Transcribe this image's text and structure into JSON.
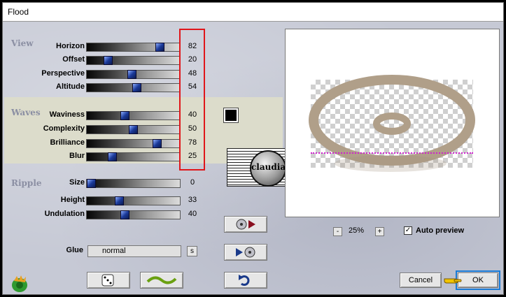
{
  "window": {
    "title": "Flood"
  },
  "sections": {
    "view": "View",
    "waves": "Waves",
    "ripple": "Ripple"
  },
  "params": [
    {
      "label": "Horizon",
      "value": 82
    },
    {
      "label": "Offset",
      "value": 20
    },
    {
      "label": "Perspective",
      "value": 48
    },
    {
      "label": "Altitude",
      "value": 54
    },
    {
      "label": "Waviness",
      "value": 40
    },
    {
      "label": "Complexity",
      "value": 50
    },
    {
      "label": "Brilliance",
      "value": 78
    },
    {
      "label": "Blur",
      "value": 25
    },
    {
      "label": "Size",
      "value": 0
    },
    {
      "label": "Height",
      "value": 33
    },
    {
      "label": "Undulation",
      "value": 40
    }
  ],
  "glue": {
    "label": "Glue",
    "value": "normal",
    "button": "s"
  },
  "color_swatch": "#000000",
  "watermark": "claudia",
  "zoom": {
    "minus": "-",
    "level": "25%",
    "plus": "+"
  },
  "auto_preview": {
    "label": "Auto preview",
    "checked": true,
    "mark": "✓"
  },
  "buttons": {
    "cancel": "Cancel",
    "ok": "OK"
  },
  "icons": [
    "filter-logo-icon",
    "dice-icon",
    "wave-icon",
    "undo-icon",
    "load-preset-icon",
    "save-preset-icon",
    "pointing-hand-icon"
  ]
}
